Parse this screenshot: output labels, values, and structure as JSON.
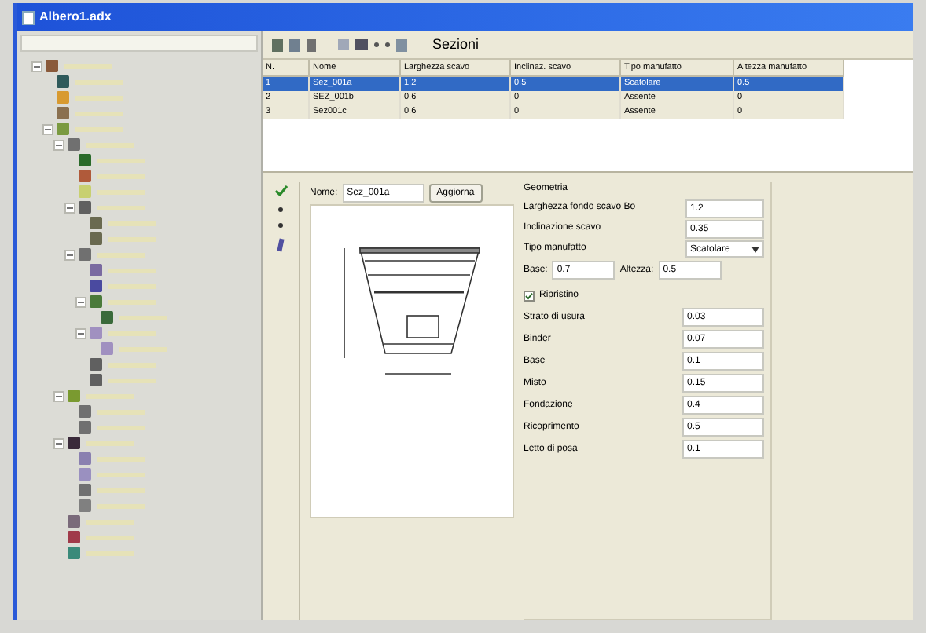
{
  "window": {
    "title": "Albero1.adx"
  },
  "sidebar": {
    "tree": [
      {
        "expanded": true,
        "color": "#8a5a3a",
        "children": [
          {
            "color": "#2f5a5a"
          },
          {
            "color": "#d89a30"
          },
          {
            "color": "#8a7050"
          },
          {
            "expanded": true,
            "color": "#7a9a40",
            "children": [
              {
                "expanded": true,
                "color": "#707070",
                "children": [
                  {
                    "color": "#2a6a2a"
                  },
                  {
                    "color": "#b05a3a"
                  },
                  {
                    "color": "#c8d070"
                  },
                  {
                    "expanded": true,
                    "color": "#606060",
                    "children": [
                      {
                        "color": "#6a6a50"
                      },
                      {
                        "color": "#6a6a50"
                      }
                    ]
                  },
                  {
                    "expanded": true,
                    "color": "#707070",
                    "children": [
                      {
                        "color": "#7a6aa0"
                      },
                      {
                        "color": "#4a4aa0"
                      },
                      {
                        "expanded": true,
                        "color": "#4a7a3a",
                        "children": [
                          {
                            "color": "#3a6a3a"
                          }
                        ]
                      },
                      {
                        "expanded": true,
                        "color": "#a090c0",
                        "children": [
                          {
                            "color": "#a090c0"
                          }
                        ]
                      },
                      {
                        "color": "#606060"
                      },
                      {
                        "color": "#606060"
                      }
                    ]
                  }
                ]
              },
              {
                "expanded": true,
                "color": "#7a9a30",
                "children": [
                  {
                    "color": "#707070"
                  },
                  {
                    "color": "#707070"
                  }
                ]
              },
              {
                "expanded": true,
                "color": "#3a2a3a",
                "children": [
                  {
                    "color": "#8a80b0"
                  },
                  {
                    "color": "#9a90c0"
                  },
                  {
                    "color": "#707070"
                  },
                  {
                    "color": "#808080"
                  }
                ]
              },
              {
                "color": "#7a6a7a"
              },
              {
                "color": "#a03a4a"
              },
              {
                "color": "#3a8a7a"
              }
            ]
          }
        ]
      }
    ]
  },
  "panel": {
    "title": "Sezioni"
  },
  "table": {
    "columns": [
      "N.",
      "Nome",
      "Larghezza scavo",
      "Inclinaz. scavo",
      "Tipo manufatto",
      "Altezza manufatto"
    ],
    "rows": [
      {
        "selected": true,
        "cells": [
          "1",
          "Sez_001a",
          "1.2",
          "0.5",
          "Scatolare",
          "0.5"
        ]
      },
      {
        "selected": false,
        "cells": [
          "2",
          "SEZ_001b",
          "0.6",
          "0",
          "Assente",
          "0"
        ]
      },
      {
        "selected": false,
        "cells": [
          "3",
          "Sez001c",
          "0.6",
          "0",
          "Assente",
          "0"
        ]
      }
    ]
  },
  "editor": {
    "name_label": "Nome:",
    "name_value": "Sez_001a",
    "update_button": "Aggiorna"
  },
  "geometry": {
    "title": "Geometria",
    "fields": [
      {
        "label": "Larghezza fondo scavo Bo",
        "value": "1.2",
        "kind": "text"
      },
      {
        "label": "Inclinazione scavo",
        "value": "0.35",
        "kind": "text"
      },
      {
        "label": "Tipo manufatto",
        "value": "Scatolare",
        "kind": "select"
      }
    ],
    "base_label": "Base:",
    "base_value": "0.7",
    "height_label": "Altezza:",
    "height_value": "0.5"
  },
  "restore": {
    "label": "Ripristino",
    "checked": true,
    "fields": [
      {
        "label": "Strato di usura",
        "value": "0.03"
      },
      {
        "label": "Binder",
        "value": "0.07"
      },
      {
        "label": "Base",
        "value": "0.1"
      },
      {
        "label": "Misto",
        "value": "0.15"
      },
      {
        "label": "Fondazione",
        "value": "0.4"
      },
      {
        "label": "Ricoprimento",
        "value": "0.5"
      },
      {
        "label": "Letto di posa",
        "value": "0.1"
      }
    ]
  }
}
